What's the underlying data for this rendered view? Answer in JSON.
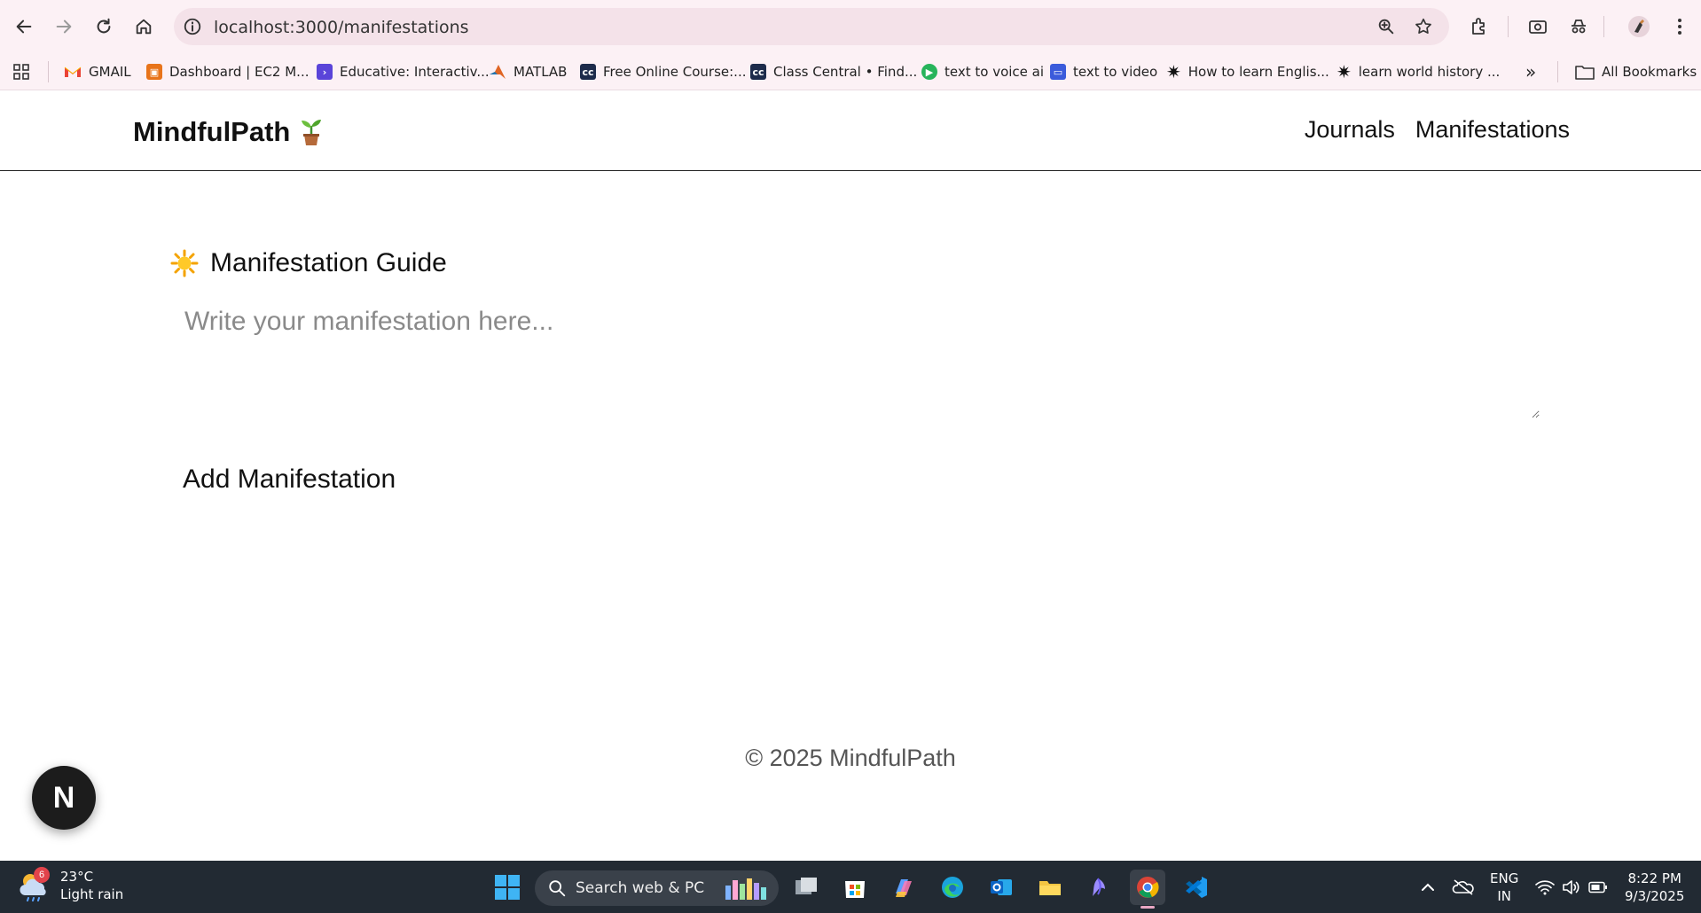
{
  "browser": {
    "url": "localhost:3000/manifestations",
    "bookmarks": [
      {
        "label": "GMAIL",
        "icon": "gmail-icon",
        "color": "#ea4335"
      },
      {
        "label": "Dashboard | EC2 M...",
        "icon": "aws-icon",
        "color": "#e8741a"
      },
      {
        "label": "Educative: Interactiv...",
        "icon": "educative-icon",
        "color": "#5a44d9"
      },
      {
        "label": "MATLAB",
        "icon": "matlab-icon",
        "color": "#e06524"
      },
      {
        "label": "Free Online Course:...",
        "icon": "class-central-icon",
        "color": "#1d2b4b"
      },
      {
        "label": "Class Central • Find...",
        "icon": "class-central-icon",
        "color": "#1d2b4b"
      },
      {
        "label": "text to voice ai",
        "icon": "play-icon",
        "color": "#27b45b"
      },
      {
        "label": "text to video",
        "icon": "video-icon",
        "color": "#3b5bdb"
      },
      {
        "label": "How to learn Englis...",
        "icon": "sparkle-icon",
        "color": "#111111"
      },
      {
        "label": "learn world history ...",
        "icon": "sparkle-icon",
        "color": "#111111"
      }
    ],
    "overflow_label": "»",
    "all_bookmarks_label": "All Bookmarks"
  },
  "site": {
    "brand": "MindfulPath",
    "nav": [
      "Journals",
      "Manifestations"
    ]
  },
  "main": {
    "section_title": "Manifestation Guide",
    "input_placeholder": "Write your manifestation here...",
    "add_button_label": "Add Manifestation"
  },
  "footer": {
    "text": "© 2025 MindfulPath"
  },
  "next_badge": {
    "letter": "N"
  },
  "taskbar": {
    "weather_badge": "6",
    "temperature": "23°C",
    "condition": "Light rain",
    "search_label": "Search web & PC",
    "lang_line1": "ENG",
    "lang_line2": "IN",
    "time": "8:22 PM",
    "date": "9/3/2025"
  }
}
